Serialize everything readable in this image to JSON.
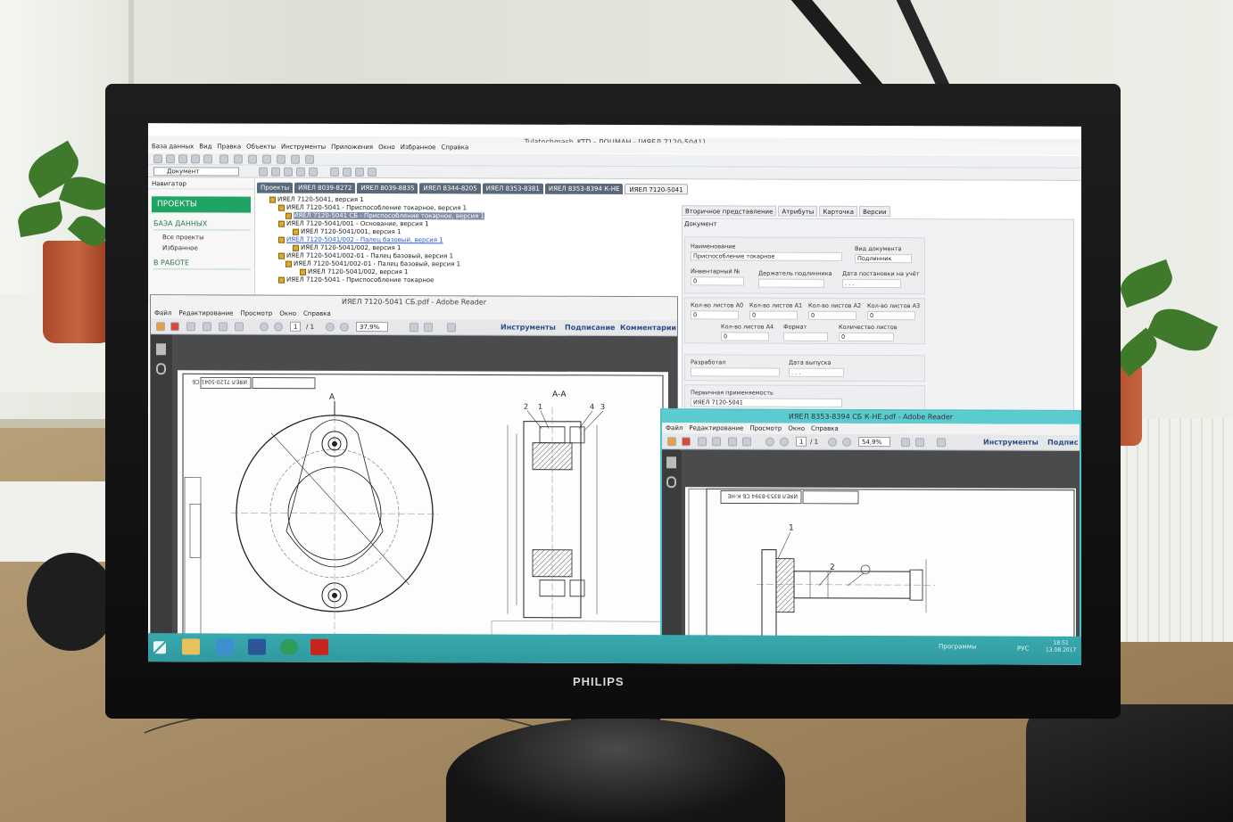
{
  "colors": {
    "accent_green": "#1fa463",
    "taskbar": "#39a9ad",
    "selection": "#7f8ea8",
    "link": "#2a5bd7"
  },
  "main_window": {
    "title": "Tulatochmash_KTD - ЛОЦМАН - [ИЯЕЛ 7120-5041]",
    "menu": [
      "База данных",
      "Вид",
      "Правка",
      "Объекты",
      "Инструменты",
      "Приложения",
      "Окно",
      "Избранное",
      "Справка"
    ],
    "doc_combo": "Документ"
  },
  "navigator": {
    "title": "Навигатор",
    "projects": "ПРОЕКТЫ",
    "database": "БАЗА ДАННЫХ",
    "all_projects": "Все проекты",
    "favorites": "Избранное",
    "in_work": "В РАБОТЕ"
  },
  "tabs": [
    "Проекты",
    "ИЯЕЛ 8039-8272",
    "ИЯЕЛ 8039-8835",
    "ИЯЕЛ 8344-8205",
    "ИЯЕЛ 8353-8381",
    "ИЯЕЛ 8353-8394 К-НЕ",
    "ИЯЕЛ 7120-5041"
  ],
  "tree": [
    "ИЯЕЛ 7120-5041, версия 1",
    "ИЯЕЛ 7120-5041 - Приспособление токарное, версия 1",
    "ИЯЕЛ 7120-5041 СБ - Приспособление токарное, версия 1",
    "ИЯЕЛ 7120-5041/001 - Основание, версия 1",
    "ИЯЕЛ 7120-5041/001, версия 1",
    "ИЯЕЛ 7120-5041/002 - Палец базовый, версия 1",
    "ИЯЕЛ 7120-5041/002, версия 1",
    "ИЯЕЛ 7120-5041/002-01 - Палец базовый, версия 1",
    "ИЯЕЛ 7120-5041/002-01 - Палец базовый, версия 1",
    "ИЯЕЛ 7120-5041/002, версия 1",
    "ИЯЕЛ 7120-5041 - Приспособление токарное"
  ],
  "properties": {
    "tabs": [
      "Вторичное представление",
      "Атрибуты",
      "Карточка",
      "Версии"
    ],
    "doc_label": "Документ",
    "name_label": "Наименование",
    "name_value": "Приспособление токарное",
    "doc_type_label": "Вид документа",
    "doc_type_value": "Подлинник",
    "inv_label": "Инвентарный №",
    "inv_value": "0",
    "holder_label": "Держатель подлинника",
    "date_label": "Дата постановки на учёт",
    "date_value": ". . .",
    "a0_label": "Кол-во листов А0",
    "a1_label": "Кол-во листов А1",
    "a2_label": "Кол-во листов А2",
    "a3_label": "Кол-во листов А3",
    "a4_label": "Кол-во листов А4",
    "format_label": "Формат",
    "sheets_label": "Количество листов",
    "zero": "0",
    "developer_label": "Разработал",
    "release_label": "Дата выпуска",
    "release_value": ". . .",
    "primary_label": "Первичная применяемость",
    "primary_value": "ИЯЕЛ 7120-5041"
  },
  "reader1": {
    "title": "ИЯЕЛ 7120-5041 СБ.pdf - Adobe Reader",
    "menu": [
      "Файл",
      "Редактирование",
      "Просмотр",
      "Окно",
      "Справка"
    ],
    "page": "1",
    "page_total": "/ 1",
    "zoom": "37,9%",
    "tools": "Инструменты",
    "sign": "Подписание",
    "comments": "Комментарии",
    "section_label": "А-А",
    "view_label": "А",
    "stamp": "ИЯЕЛ 7120-5041 СБ",
    "callouts": [
      "2",
      "1",
      "4",
      "3"
    ]
  },
  "reader2": {
    "title": "ИЯЕЛ 8353-8394 СБ К-НЕ.pdf - Adobe Reader",
    "menu": [
      "Файл",
      "Редактирование",
      "Просмотр",
      "Окно",
      "Справка"
    ],
    "page": "1",
    "page_total": "/ 1",
    "zoom": "54,9%",
    "tools": "Инструменты",
    "sign": "Подпис",
    "stamp": "ИЯЕЛ 8353-8394 СБ К-НЕ",
    "callouts": [
      "1",
      "2"
    ]
  },
  "taskbar": {
    "programs": "Программы",
    "lang": "РУС",
    "time": "18:51",
    "date": "13.08.2017"
  },
  "monitor": {
    "brand": "PHILIPS"
  }
}
